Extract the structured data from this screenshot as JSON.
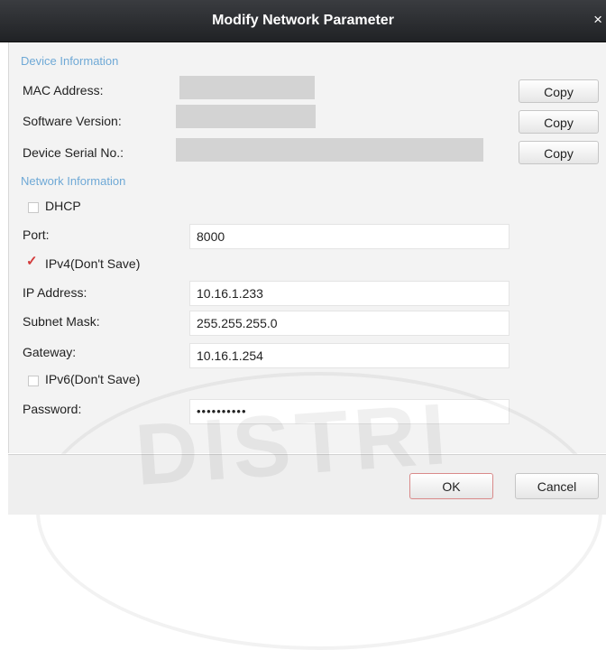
{
  "window": {
    "title": "Modify Network Parameter",
    "close_glyph": "×",
    "close_icon": "close-icon"
  },
  "device_info": {
    "section_label": "Device Information",
    "mac_label": "MAC Address:",
    "software_label": "Software Version:",
    "serial_label": "Device Serial No.:",
    "copy_label": "Copy"
  },
  "network_info": {
    "section_label": "Network Information",
    "dhcp_label": "DHCP",
    "dhcp_checked": false,
    "port_label": "Port:",
    "port_value": "8000",
    "ipv4_label": "IPv4(Don't Save)",
    "ipv4_checked": true,
    "ip_label": "IP Address:",
    "ip_value": "10.16.1.233",
    "subnet_label": "Subnet Mask:",
    "subnet_value": "255.255.255.0",
    "gateway_label": "Gateway:",
    "gateway_value": "10.16.1.254",
    "ipv6_label": "IPv6(Don't Save)",
    "ipv6_checked": false,
    "password_label": "Password:",
    "password_value": "••••••••••"
  },
  "footer": {
    "ok_label": "OK",
    "cancel_label": "Cancel"
  },
  "watermark": "DISTRI",
  "colors": {
    "titlebar": "#2a2c30",
    "section_text": "#6fa9d6",
    "check_tick": "#d33a3a",
    "ok_border": "#d98a8a"
  }
}
